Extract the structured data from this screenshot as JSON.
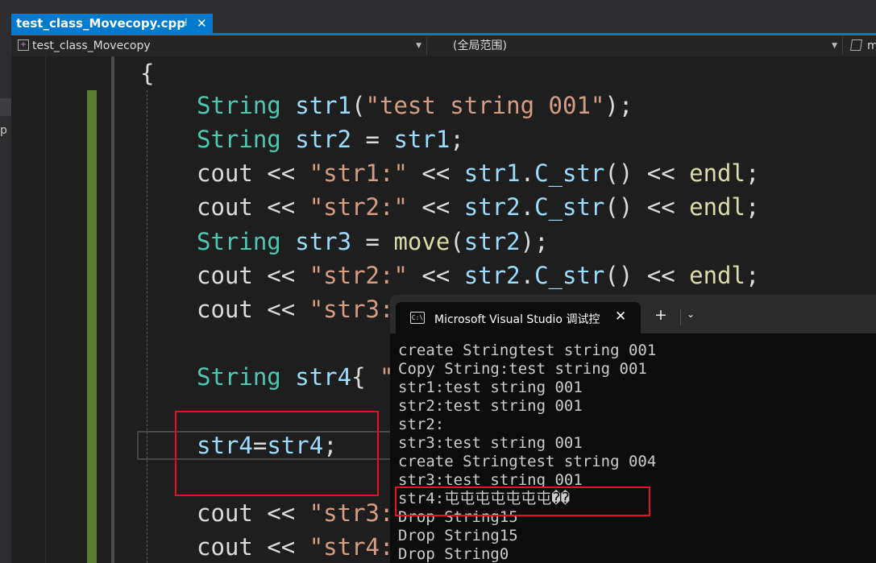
{
  "tab": {
    "filename": "test_class_Movecopy.cpp",
    "pin_icon": "⊣",
    "close_icon": "✕"
  },
  "nav": {
    "project": "test_class_Movecopy",
    "scope": "(全局范围)",
    "member": "m"
  },
  "left_strip": {
    "letter": "p"
  },
  "code": {
    "open_brace": "{",
    "lines": [
      [
        {
          "t": "String",
          "c": "ty"
        },
        {
          "t": " "
        },
        {
          "t": "str1",
          "c": "var"
        },
        {
          "t": "("
        },
        {
          "t": "\"test string 001\"",
          "c": "str"
        },
        {
          "t": ");"
        }
      ],
      [
        {
          "t": "String",
          "c": "ty"
        },
        {
          "t": " "
        },
        {
          "t": "str2",
          "c": "var"
        },
        {
          "t": " = "
        },
        {
          "t": "str1",
          "c": "var"
        },
        {
          "t": ";"
        }
      ],
      [
        {
          "t": "cout"
        },
        {
          "t": " << "
        },
        {
          "t": "\"str1:\"",
          "c": "str"
        },
        {
          "t": " << "
        },
        {
          "t": "str1",
          "c": "var"
        },
        {
          "t": "."
        },
        {
          "t": "C_str",
          "c": "var"
        },
        {
          "t": "() << "
        },
        {
          "t": "endl",
          "c": "fn"
        },
        {
          "t": ";"
        }
      ],
      [
        {
          "t": "cout"
        },
        {
          "t": " << "
        },
        {
          "t": "\"str2:\"",
          "c": "str"
        },
        {
          "t": " << "
        },
        {
          "t": "str2",
          "c": "var"
        },
        {
          "t": "."
        },
        {
          "t": "C_str",
          "c": "var"
        },
        {
          "t": "() << "
        },
        {
          "t": "endl",
          "c": "fn"
        },
        {
          "t": ";"
        }
      ],
      [
        {
          "t": "String",
          "c": "ty"
        },
        {
          "t": " "
        },
        {
          "t": "str3",
          "c": "var"
        },
        {
          "t": " = "
        },
        {
          "t": "move",
          "c": "fn"
        },
        {
          "t": "("
        },
        {
          "t": "str2",
          "c": "var"
        },
        {
          "t": ");"
        }
      ],
      [
        {
          "t": "cout"
        },
        {
          "t": " << "
        },
        {
          "t": "\"str2:\"",
          "c": "str"
        },
        {
          "t": " << "
        },
        {
          "t": "str2",
          "c": "var"
        },
        {
          "t": "."
        },
        {
          "t": "C_str",
          "c": "var"
        },
        {
          "t": "() << "
        },
        {
          "t": "endl",
          "c": "fn"
        },
        {
          "t": ";"
        }
      ],
      [
        {
          "t": "cout"
        },
        {
          "t": " << "
        },
        {
          "t": "\"str3:",
          "c": "str"
        }
      ],
      [],
      [
        {
          "t": "String",
          "c": "ty"
        },
        {
          "t": " "
        },
        {
          "t": "str4",
          "c": "var"
        },
        {
          "t": "{ "
        },
        {
          "t": "\"",
          "c": "str"
        }
      ],
      [],
      [
        {
          "t": "str4",
          "c": "var"
        },
        {
          "t": "="
        },
        {
          "t": "str4",
          "c": "var"
        },
        {
          "t": ";"
        }
      ],
      [],
      [
        {
          "t": "cout"
        },
        {
          "t": " << "
        },
        {
          "t": "\"str3:",
          "c": "str"
        }
      ],
      [
        {
          "t": "cout"
        },
        {
          "t": " << "
        },
        {
          "t": "\"str4:",
          "c": "str"
        }
      ]
    ]
  },
  "console": {
    "title": "Microsoft Visual Studio 调试控",
    "tab_icon": "C:\\",
    "close_icon": "✕",
    "new_tab_icon": "+",
    "dropdown_icon": "⌄",
    "output": [
      "create Stringtest string 001",
      "Copy String:test string 001",
      "str1:test string 001",
      "str2:test string 001",
      "str2:",
      "str3:test string 001",
      "create Stringtest string 004",
      "str3:test string 001",
      "str4:屯屯屯屯屯屯屯��",
      "Drop String15",
      "Drop String15",
      "Drop String0"
    ]
  }
}
